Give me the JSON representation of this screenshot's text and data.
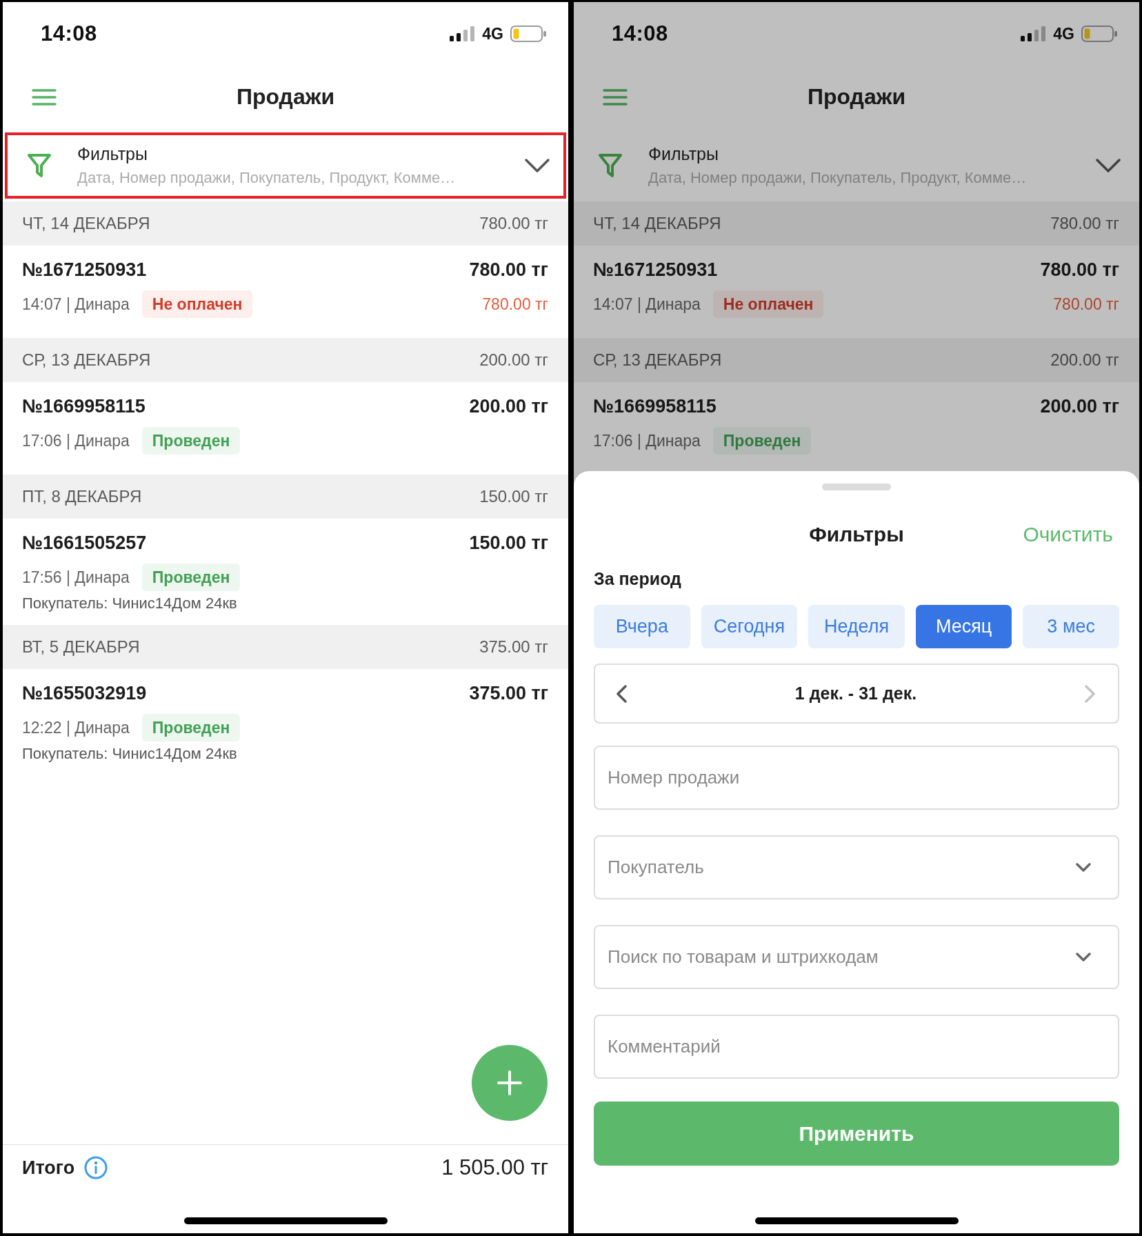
{
  "screens": [
    {
      "dimmed": false,
      "status_bar": {
        "time": "14:08",
        "network": "4G"
      },
      "header": {
        "title": "Продажи"
      },
      "filter_bar": {
        "title": "Фильтры",
        "summary": "Дата, Номер продажи, Покупатель, Продукт, Комме…",
        "highlighted": true
      },
      "days": [
        {
          "date": "ЧТ, 14 ДЕКАБРЯ",
          "total": "780.00 тг",
          "sales": [
            {
              "number": "№1671250931",
              "amount": "780.00 тг",
              "meta": "14:07 | Динара",
              "status": {
                "label": "Не оплачен",
                "kind": "unpaid"
              },
              "due": "780.00 тг"
            }
          ]
        },
        {
          "date": "СР, 13 ДЕКАБРЯ",
          "total": "200.00 тг",
          "sales": [
            {
              "number": "№1669958115",
              "amount": "200.00 тг",
              "meta": "17:06 | Динара",
              "status": {
                "label": "Проведен",
                "kind": "paid"
              }
            }
          ]
        },
        {
          "date": "ПТ, 8 ДЕКАБРЯ",
          "total": "150.00 тг",
          "sales": [
            {
              "number": "№1661505257",
              "amount": "150.00 тг",
              "meta": "17:56 | Динара",
              "status": {
                "label": "Проведен",
                "kind": "paid"
              },
              "buyer": "Покупатель: Чинис14Дом 24кв"
            }
          ]
        },
        {
          "date": "ВТ, 5 ДЕКАБРЯ",
          "total": "375.00 тг",
          "sales": [
            {
              "number": "№1655032919",
              "amount": "375.00 тг",
              "meta": "12:22 | Динара",
              "status": {
                "label": "Проведен",
                "kind": "paid"
              },
              "buyer": "Покупатель: Чинис14Дом 24кв"
            }
          ]
        }
      ],
      "add_button": true,
      "total": {
        "label": "Итого",
        "amount": "1 505.00 тг"
      }
    },
    {
      "dimmed": true,
      "status_bar": {
        "time": "14:08",
        "network": "4G"
      },
      "header": {
        "title": "Продажи"
      },
      "filter_bar": {
        "title": "Фильтры",
        "summary": "Дата, Номер продажи, Покупатель, Продукт, Комме…",
        "highlighted": false
      },
      "days": [
        {
          "date": "ЧТ, 14 ДЕКАБРЯ",
          "total": "780.00 тг",
          "sales": [
            {
              "number": "№1671250931",
              "amount": "780.00 тг",
              "meta": "14:07 | Динара",
              "status": {
                "label": "Не оплачен",
                "kind": "unpaid"
              },
              "due": "780.00 тг"
            }
          ]
        },
        {
          "date": "СР, 13 ДЕКАБРЯ",
          "total": "200.00 тг",
          "sales": [
            {
              "number": "№1669958115",
              "amount": "200.00 тг",
              "meta": "17:06 | Динара",
              "status": {
                "label": "Проведен",
                "kind": "paid"
              }
            }
          ]
        }
      ],
      "filter_sheet": {
        "title": "Фильтры",
        "clear": "Очистить",
        "period_label": "За период",
        "periods": [
          {
            "label": "Вчера",
            "selected": false
          },
          {
            "label": "Сегодня",
            "selected": false
          },
          {
            "label": "Неделя",
            "selected": false
          },
          {
            "label": "Месяц",
            "selected": true
          },
          {
            "label": "3 мес",
            "selected": false
          }
        ],
        "range": {
          "label": "1 дек. - 31 дек.",
          "prev_disabled": false,
          "next_disabled": true
        },
        "fields": [
          {
            "kind": "text",
            "placeholder": "Номер продажи"
          },
          {
            "kind": "select",
            "placeholder": "Покупатель"
          },
          {
            "kind": "select",
            "placeholder": "Поиск по товарам и штрихкодам"
          },
          {
            "kind": "text",
            "placeholder": "Комментарий"
          }
        ],
        "apply": "Применить"
      }
    }
  ]
}
